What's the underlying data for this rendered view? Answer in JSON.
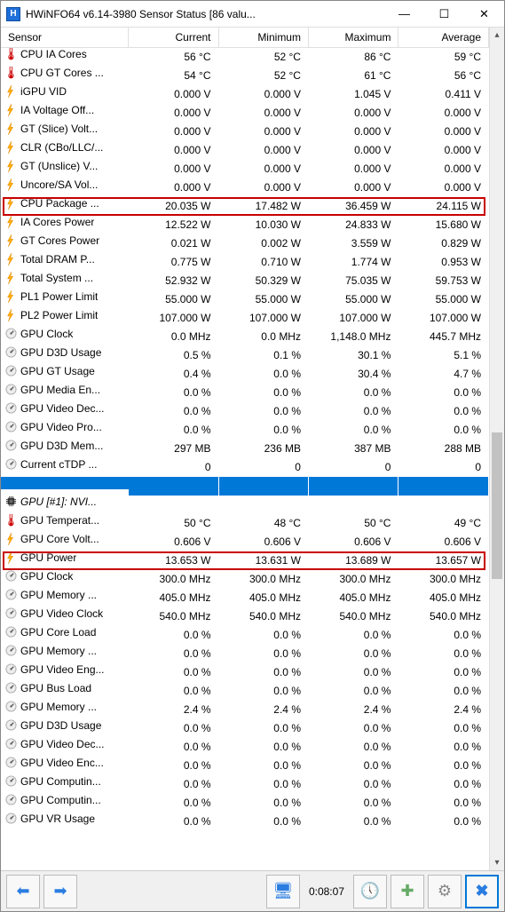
{
  "window": {
    "title": "HWiNFO64 v6.14-3980 Sensor Status [86 valu..."
  },
  "columns": [
    "Sensor",
    "Current",
    "Minimum",
    "Maximum",
    "Average"
  ],
  "status": {
    "elapsed": "0:08:07"
  },
  "highlights": [
    "row-cpu-package",
    "row-gpu-power"
  ],
  "rows": [
    {
      "id": "r0",
      "icon": "temp",
      "label": "CPU IA Cores",
      "v": [
        "56 °C",
        "52 °C",
        "86 °C",
        "59 °C"
      ]
    },
    {
      "id": "r1",
      "icon": "temp",
      "label": "CPU GT Cores ...",
      "v": [
        "54 °C",
        "52 °C",
        "61 °C",
        "56 °C"
      ]
    },
    {
      "id": "r2",
      "icon": "bolt",
      "label": "iGPU VID",
      "v": [
        "0.000 V",
        "0.000 V",
        "1.045 V",
        "0.411 V"
      ]
    },
    {
      "id": "r3",
      "icon": "bolt",
      "label": "IA Voltage Off...",
      "v": [
        "0.000 V",
        "0.000 V",
        "0.000 V",
        "0.000 V"
      ]
    },
    {
      "id": "r4",
      "icon": "bolt",
      "label": "GT (Slice) Volt...",
      "v": [
        "0.000 V",
        "0.000 V",
        "0.000 V",
        "0.000 V"
      ]
    },
    {
      "id": "r5",
      "icon": "bolt",
      "label": "CLR (CBo/LLC/...",
      "v": [
        "0.000 V",
        "0.000 V",
        "0.000 V",
        "0.000 V"
      ]
    },
    {
      "id": "r6",
      "icon": "bolt",
      "label": "GT (Unslice) V...",
      "v": [
        "0.000 V",
        "0.000 V",
        "0.000 V",
        "0.000 V"
      ]
    },
    {
      "id": "r7",
      "icon": "bolt",
      "label": "Uncore/SA Vol...",
      "v": [
        "0.000 V",
        "0.000 V",
        "0.000 V",
        "0.000 V"
      ]
    },
    {
      "id": "row-cpu-package",
      "icon": "bolt",
      "label": "CPU Package ...",
      "v": [
        "20.035 W",
        "17.482 W",
        "36.459 W",
        "24.115 W"
      ],
      "hl": true
    },
    {
      "id": "r9",
      "icon": "bolt",
      "label": "IA Cores Power",
      "v": [
        "12.522 W",
        "10.030 W",
        "24.833 W",
        "15.680 W"
      ]
    },
    {
      "id": "r10",
      "icon": "bolt",
      "label": "GT Cores Power",
      "v": [
        "0.021 W",
        "0.002 W",
        "3.559 W",
        "0.829 W"
      ]
    },
    {
      "id": "r11",
      "icon": "bolt",
      "label": "Total DRAM P...",
      "v": [
        "0.775 W",
        "0.710 W",
        "1.774 W",
        "0.953 W"
      ]
    },
    {
      "id": "r12",
      "icon": "bolt",
      "label": "Total System ...",
      "v": [
        "52.932 W",
        "50.329 W",
        "75.035 W",
        "59.753 W"
      ]
    },
    {
      "id": "r13",
      "icon": "bolt",
      "label": "PL1 Power Limit",
      "v": [
        "55.000 W",
        "55.000 W",
        "55.000 W",
        "55.000 W"
      ]
    },
    {
      "id": "r14",
      "icon": "bolt",
      "label": "PL2 Power Limit",
      "v": [
        "107.000 W",
        "107.000 W",
        "107.000 W",
        "107.000 W"
      ]
    },
    {
      "id": "r15",
      "icon": "dial",
      "label": "GPU Clock",
      "v": [
        "0.0 MHz",
        "0.0 MHz",
        "1,148.0 MHz",
        "445.7 MHz"
      ]
    },
    {
      "id": "r16",
      "icon": "dial",
      "label": "GPU D3D Usage",
      "v": [
        "0.5 %",
        "0.1 %",
        "30.1 %",
        "5.1 %"
      ]
    },
    {
      "id": "r17",
      "icon": "dial",
      "label": "GPU GT Usage",
      "v": [
        "0.4 %",
        "0.0 %",
        "30.4 %",
        "4.7 %"
      ]
    },
    {
      "id": "r18",
      "icon": "dial",
      "label": "GPU Media En...",
      "v": [
        "0.0 %",
        "0.0 %",
        "0.0 %",
        "0.0 %"
      ]
    },
    {
      "id": "r19",
      "icon": "dial",
      "label": "GPU Video Dec...",
      "v": [
        "0.0 %",
        "0.0 %",
        "0.0 %",
        "0.0 %"
      ]
    },
    {
      "id": "r20",
      "icon": "dial",
      "label": "GPU Video Pro...",
      "v": [
        "0.0 %",
        "0.0 %",
        "0.0 %",
        "0.0 %"
      ]
    },
    {
      "id": "r21",
      "icon": "dial",
      "label": "GPU D3D Mem...",
      "v": [
        "297 MB",
        "236 MB",
        "387 MB",
        "288 MB"
      ]
    },
    {
      "id": "r22",
      "icon": "dial",
      "label": "Current cTDP ...",
      "v": [
        "0",
        "0",
        "0",
        "0"
      ]
    },
    {
      "id": "r23",
      "selected": true,
      "label": "",
      "v": [
        "",
        "",
        "",
        ""
      ]
    },
    {
      "id": "r24",
      "icon": "chip",
      "group": true,
      "label": "GPU [#1]: NVI...",
      "v": [
        "",
        "",
        "",
        ""
      ]
    },
    {
      "id": "r25",
      "icon": "temp",
      "label": "GPU Temperat...",
      "v": [
        "50 °C",
        "48 °C",
        "50 °C",
        "49 °C"
      ]
    },
    {
      "id": "r26",
      "icon": "bolt",
      "label": "GPU Core Volt...",
      "v": [
        "0.606 V",
        "0.606 V",
        "0.606 V",
        "0.606 V"
      ]
    },
    {
      "id": "row-gpu-power",
      "icon": "bolt",
      "label": "GPU Power",
      "v": [
        "13.653 W",
        "13.631 W",
        "13.689 W",
        "13.657 W"
      ],
      "hl": true
    },
    {
      "id": "r28",
      "icon": "dial",
      "label": "GPU Clock",
      "v": [
        "300.0 MHz",
        "300.0 MHz",
        "300.0 MHz",
        "300.0 MHz"
      ]
    },
    {
      "id": "r29",
      "icon": "dial",
      "label": "GPU Memory ...",
      "v": [
        "405.0 MHz",
        "405.0 MHz",
        "405.0 MHz",
        "405.0 MHz"
      ]
    },
    {
      "id": "r30",
      "icon": "dial",
      "label": "GPU Video Clock",
      "v": [
        "540.0 MHz",
        "540.0 MHz",
        "540.0 MHz",
        "540.0 MHz"
      ]
    },
    {
      "id": "r31",
      "icon": "dial",
      "label": "GPU Core Load",
      "v": [
        "0.0 %",
        "0.0 %",
        "0.0 %",
        "0.0 %"
      ]
    },
    {
      "id": "r32",
      "icon": "dial",
      "label": "GPU Memory ...",
      "v": [
        "0.0 %",
        "0.0 %",
        "0.0 %",
        "0.0 %"
      ]
    },
    {
      "id": "r33",
      "icon": "dial",
      "label": "GPU Video Eng...",
      "v": [
        "0.0 %",
        "0.0 %",
        "0.0 %",
        "0.0 %"
      ]
    },
    {
      "id": "r34",
      "icon": "dial",
      "label": "GPU Bus Load",
      "v": [
        "0.0 %",
        "0.0 %",
        "0.0 %",
        "0.0 %"
      ]
    },
    {
      "id": "r35",
      "icon": "dial",
      "label": "GPU Memory ...",
      "v": [
        "2.4 %",
        "2.4 %",
        "2.4 %",
        "2.4 %"
      ]
    },
    {
      "id": "r36",
      "icon": "dial",
      "label": "GPU D3D Usage",
      "v": [
        "0.0 %",
        "0.0 %",
        "0.0 %",
        "0.0 %"
      ]
    },
    {
      "id": "r37",
      "icon": "dial",
      "label": "GPU Video Dec...",
      "v": [
        "0.0 %",
        "0.0 %",
        "0.0 %",
        "0.0 %"
      ]
    },
    {
      "id": "r38",
      "icon": "dial",
      "label": "GPU Video Enc...",
      "v": [
        "0.0 %",
        "0.0 %",
        "0.0 %",
        "0.0 %"
      ]
    },
    {
      "id": "r39",
      "icon": "dial",
      "label": "GPU Computin...",
      "v": [
        "0.0 %",
        "0.0 %",
        "0.0 %",
        "0.0 %"
      ]
    },
    {
      "id": "r40",
      "icon": "dial",
      "label": "GPU Computin...",
      "v": [
        "0.0 %",
        "0.0 %",
        "0.0 %",
        "0.0 %"
      ]
    },
    {
      "id": "r41",
      "icon": "dial",
      "label": "GPU VR Usage",
      "v": [
        "0.0 %",
        "0.0 %",
        "0.0 %",
        "0.0 %"
      ]
    }
  ]
}
